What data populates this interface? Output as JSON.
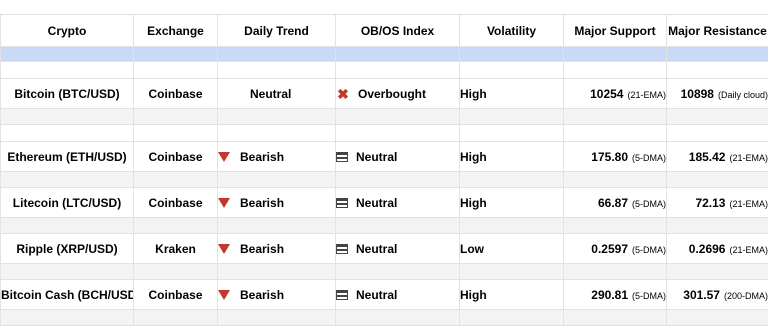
{
  "columns": [
    "Crypto",
    "Exchange",
    "Daily Trend",
    "OB/OS Index",
    "Volatility",
    "Major Support",
    "Major Resistance"
  ],
  "rows": [
    {
      "crypto": "Bitcoin (BTC/USD)",
      "exchange": "Coinbase",
      "trend": "Neutral",
      "trend_icon": "none",
      "index": "Overbought",
      "index_icon": "x-mark-icon",
      "volatility": "High",
      "support": "10254",
      "support_note": "(21-EMA)",
      "resistance": "10898",
      "resistance_note": "(Daily cloud)"
    },
    {
      "crypto": "Ethereum (ETH/USD)",
      "exchange": "Coinbase",
      "trend": "Bearish",
      "trend_icon": "down-triangle-icon",
      "index": "Neutral",
      "index_icon": "equals-icon",
      "volatility": "High",
      "support": "175.80",
      "support_note": "(5-DMA)",
      "resistance": "185.42",
      "resistance_note": "(21-EMA)"
    },
    {
      "crypto": "Litecoin (LTC/USD)",
      "exchange": "Coinbase",
      "trend": "Bearish",
      "trend_icon": "down-triangle-icon",
      "index": "Neutral",
      "index_icon": "equals-icon",
      "volatility": "High",
      "support": "66.87",
      "support_note": "(5-DMA)",
      "resistance": "72.13",
      "resistance_note": "(21-EMA)"
    },
    {
      "crypto": "Ripple (XRP/USD)",
      "exchange": "Kraken",
      "trend": "Bearish",
      "trend_icon": "down-triangle-icon",
      "index": "Neutral",
      "index_icon": "equals-icon",
      "volatility": "Low",
      "support": "0.2597",
      "support_note": "(5-DMA)",
      "resistance": "0.2696",
      "resistance_note": "(21-EMA)"
    },
    {
      "crypto": "Bitcoin Cash (BCH/USD)",
      "exchange": "Coinbase",
      "trend": "Bearish",
      "trend_icon": "down-triangle-icon",
      "index": "Neutral",
      "index_icon": "equals-icon",
      "volatility": "High",
      "support": "290.81",
      "support_note": "(5-DMA)",
      "resistance": "301.57",
      "resistance_note": "(200-DMA)"
    }
  ],
  "colors": {
    "header_band": "#c9daf8",
    "gap_row": "#f3f3f3",
    "bearish_triangle": "#c0392b",
    "overbought_x": "#c0392b",
    "grid_line": "#e2e2e2"
  }
}
